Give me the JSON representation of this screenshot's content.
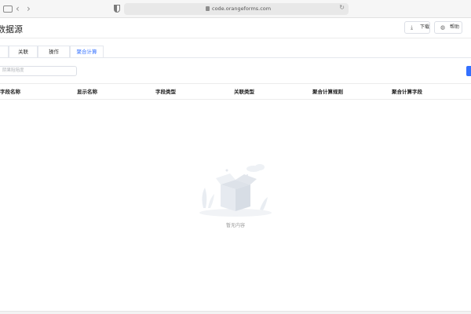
{
  "browser": {
    "url": "code.orangeforms.com",
    "back_symbol": "‹",
    "forward_symbol": "›",
    "reload_symbol": "↻"
  },
  "header": {
    "title": "数据源",
    "download_label": "下载",
    "help_label": "帮助",
    "download_icon": "⤓",
    "help_icon": "◍"
  },
  "tabs": [
    {
      "label": "",
      "active": false
    },
    {
      "label": "关联",
      "active": false
    },
    {
      "label": "操作",
      "active": false
    },
    {
      "label": "聚合计算",
      "active": true
    }
  ],
  "search": {
    "placeholder": "阴果阻陪度"
  },
  "table": {
    "columns": [
      "字段名称",
      "显示名称",
      "字段类型",
      "关联类型",
      "聚合计算规则",
      "聚合计算字段"
    ],
    "rows": []
  },
  "empty_state": {
    "text": "暂无内容"
  },
  "colors": {
    "accent": "#3370ff",
    "border": "#e4e7ed"
  }
}
